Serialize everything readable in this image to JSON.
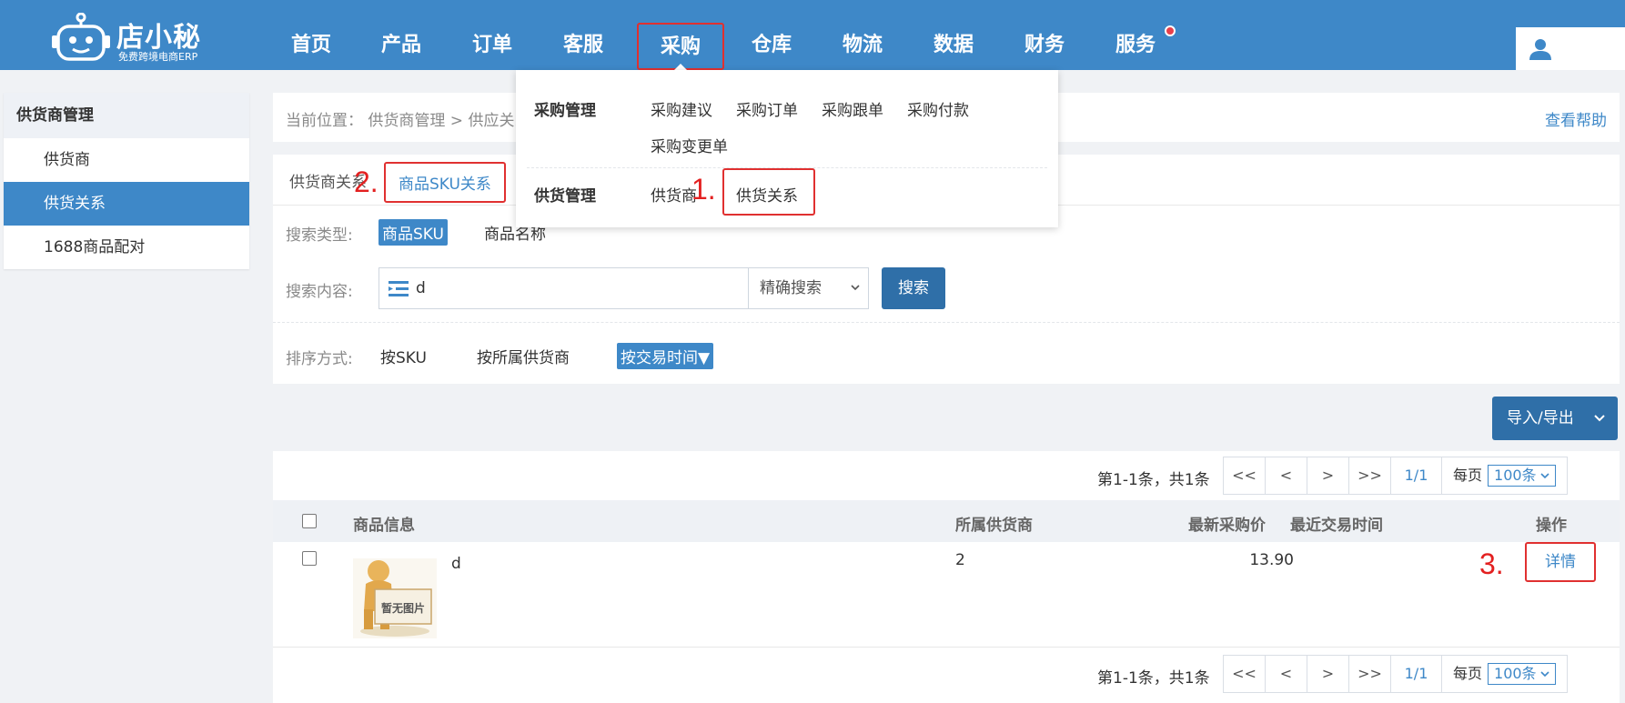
{
  "header": {
    "logo_text": "店小秘",
    "logo_sub": "免费跨境电商ERP",
    "nav": [
      {
        "label": "首页"
      },
      {
        "label": "产品"
      },
      {
        "label": "订单"
      },
      {
        "label": "客服"
      },
      {
        "label": "采购",
        "active": true
      },
      {
        "label": "仓库"
      },
      {
        "label": "物流"
      },
      {
        "label": "数据"
      },
      {
        "label": "财务"
      },
      {
        "label": "服务",
        "has_dot": true
      }
    ],
    "accent": "#3e88c8",
    "user_icon": "user-icon"
  },
  "dropdown": {
    "group1_title": "采购管理",
    "group1_links": [
      "采购建议",
      "采购订单",
      "采购跟单",
      "采购付款",
      "采购变更单"
    ],
    "group2_title": "供货管理",
    "group2_links": [
      "供货商",
      "供货关系"
    ]
  },
  "sidebar": {
    "title": "供货商管理",
    "items": [
      {
        "label": "供货商"
      },
      {
        "label": "供货关系",
        "active": true
      },
      {
        "label": "1688商品配对"
      }
    ]
  },
  "breadcrumb": {
    "text": "当前位置：  供货商管理 > 供应关系",
    "help": "查看帮助"
  },
  "tabs": {
    "items": [
      {
        "label": "供货商关系"
      },
      {
        "label": "商品SKU关系",
        "active": true
      }
    ]
  },
  "filters": {
    "search_type_label": "搜索类型:",
    "search_types": [
      "商品SKU",
      "商品名称"
    ],
    "search_content_label": "搜索内容:",
    "search_value": "d",
    "search_mode": "精确搜索",
    "search_button": "搜索",
    "sort_label": "排序方式:",
    "sort_options": [
      "按SKU",
      "按所属供货商",
      "按交易时间▼"
    ]
  },
  "actions": {
    "import_export": "导入/导出"
  },
  "pager": {
    "summary": "第1-1条，共1条",
    "first": "<<",
    "prev": "<",
    "next": ">",
    "last": ">>",
    "page": "1/1",
    "per_page_label": "每页",
    "per_page_value": "100条"
  },
  "table": {
    "columns": [
      "商品信息",
      "所属供货商",
      "最新采购价",
      "最近交易时间",
      "操作"
    ],
    "rows": [
      {
        "name": "d",
        "image_caption": "暂无图片",
        "supplier": "2",
        "price": "13.90",
        "last_trade": "",
        "action": "详情"
      }
    ]
  },
  "annotations": {
    "step1": "1.",
    "step2": "2.",
    "step3": "3."
  }
}
